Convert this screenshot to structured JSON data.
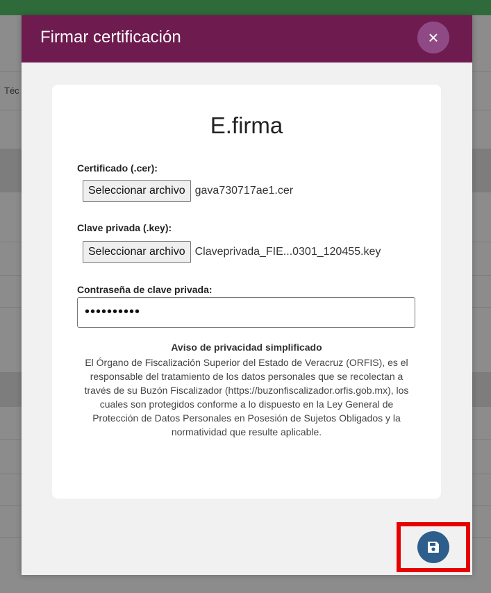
{
  "background": {
    "partial_text": "Téc"
  },
  "modal": {
    "title": "Firmar certificación",
    "close_label": "×"
  },
  "card": {
    "title": "E.firma",
    "certificate": {
      "label": "Certificado (.cer):",
      "button": "Seleccionar archivo",
      "file": "gava730717ae1.cer"
    },
    "private_key": {
      "label": "Clave privada (.key):",
      "button": "Seleccionar archivo",
      "file": "Claveprivada_FIE...0301_120455.key"
    },
    "password": {
      "label": "Contraseña de clave privada:",
      "masked_value": "••••••••••"
    },
    "notice": {
      "title": "Aviso de privacidad simplificado",
      "text": "El Órgano de Fiscalización Superior del Estado de Veracruz (ORFIS), es el responsable del tratamiento de los datos personales que se recolectan a través de su Buzón Fiscalizador (https://buzonfiscalizador.orfis.gob.mx), los cuales son protegidos conforme a lo dispuesto en la Ley General de Protección de Datos Personales en Posesión de Sujetos Obligados y la normatividad que resulte aplicable."
    }
  },
  "footer": {
    "save_icon": "floppy-disk-icon"
  },
  "colors": {
    "header": "#6e1b4f",
    "close_button": "#8f4a86",
    "save_button": "#2d5e8c",
    "highlight": "#e60000",
    "top_bar": "#2f6b3a"
  }
}
